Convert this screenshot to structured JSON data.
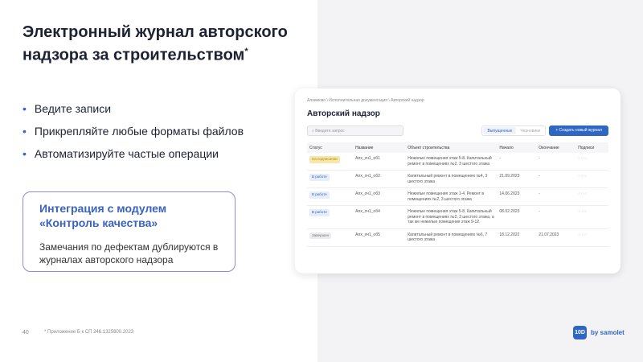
{
  "slide": {
    "title": "Электронный журнал авторского надзора за строительством",
    "title_mark": "*",
    "bullets": [
      "Ведите записи",
      "Прикрепляйте любые форматы файлов",
      "Автоматизируйте частые операции"
    ],
    "box": {
      "title": "Интеграция с модулем «Контроль качества»",
      "body": "Замечания по дефектам дублируются в журналах авторского надзора"
    },
    "page_number": "40",
    "footnote": "* Приложение Б к СП 246.1325800.2023",
    "logo": {
      "badge": "10D",
      "text": "by samolet"
    }
  },
  "app": {
    "breadcrumb": "Алхимово  \\  Исполнительная документация  \\  Авторский надзор",
    "title": "Авторский надзор",
    "search_placeholder": "Введите запрос",
    "tabs": [
      "Выпущенные",
      "Черновики"
    ],
    "create_label": "+ Создать новый журнал",
    "columns": [
      "Статус",
      "Название",
      "Объект строительства",
      "Начало",
      "Окончание",
      "Подписи"
    ],
    "rows": [
      {
        "status": "На подписании",
        "status_color": "#f7e7a8",
        "status_text_color": "#b08a1a",
        "name": "Алх_оч1_об1",
        "object": "Нежилые помещения этаж 5-8. Капитальный ремонт в помещениях №2, 3 шестого этажа",
        "start": "-",
        "end": "-",
        "signs": "◌◌◌"
      },
      {
        "status": "В работе",
        "status_color": "#e6eefa",
        "status_text_color": "#3a62c0",
        "name": "Алх_оч1_об2",
        "object": "Капитальный ремонт в помещениях №4, 3 шестого этажа",
        "start": "21.09.2023",
        "end": "-",
        "signs": "◌◌◌"
      },
      {
        "status": "В работе",
        "status_color": "#e6eefa",
        "status_text_color": "#3a62c0",
        "name": "Алх_оч1_об3",
        "object": "Нежилые помещения этаж 1-4. Ремонт в помещениях №2, 3 шестого этажа",
        "start": "14.06.2023",
        "end": "-",
        "signs": "◌◌◌"
      },
      {
        "status": "В работе",
        "status_color": "#e6eefa",
        "status_text_color": "#3a62c0",
        "name": "Алх_оч1_об4",
        "object": "Нежилые помещения этаж 5-8. Капитальный ремонт в помещениях №2, 3 шестого этажа, а так же нежилые помещения этаж 9-12.",
        "start": "08.02.2023",
        "end": "-",
        "signs": "◌◌◌"
      },
      {
        "status": "Завершен",
        "status_color": "#ececef",
        "status_text_color": "#777",
        "name": "Алх_оч1_об5",
        "object": "Капитальный ремонт в помещениях №6, 7 шестого этажа",
        "start": "18.12.2022",
        "end": "21.07.2023",
        "signs": "◌◌◌"
      }
    ]
  }
}
